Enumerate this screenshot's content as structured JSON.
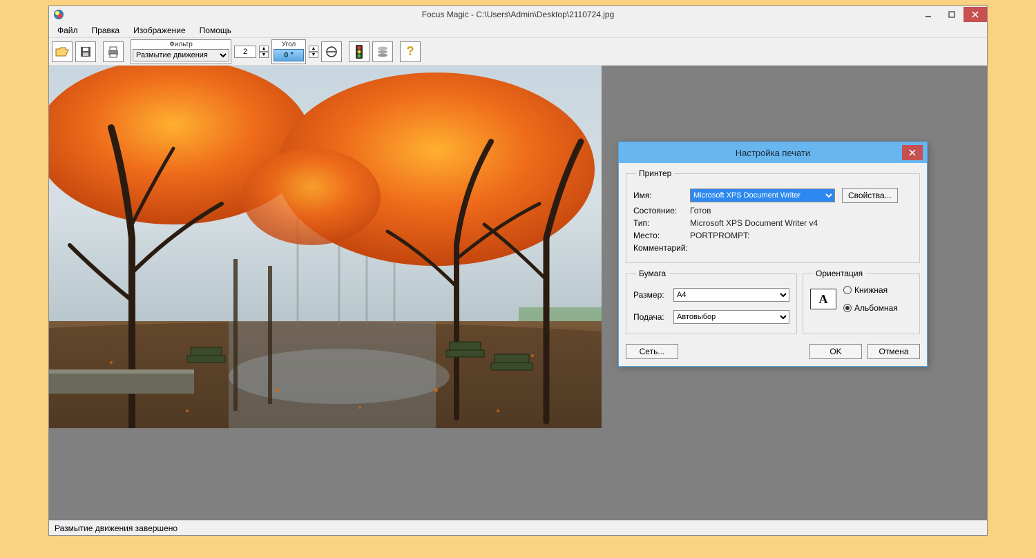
{
  "window": {
    "title": "Focus Magic - C:\\Users\\Admin\\Desktop\\2110724.jpg"
  },
  "menu": {
    "file": "Файл",
    "edit": "Правка",
    "image": "Изображение",
    "help": "Помощь"
  },
  "toolbar": {
    "filter_label": "Фильтр",
    "filter_value": "Размытие движения",
    "number_value": "2",
    "angle_label": "Угол",
    "angle_value": "0 °"
  },
  "status": {
    "text": "Размытие движения завершено"
  },
  "dialog": {
    "title": "Настройка печати",
    "printer_legend": "Принтер",
    "name_label": "Имя:",
    "name_value": "Microsoft XPS Document Writer",
    "properties_btn": "Свойства...",
    "state_label": "Состояние:",
    "state_value": "Готов",
    "type_label": "Тип:",
    "type_value": "Microsoft XPS Document Writer v4",
    "place_label": "Место:",
    "place_value": "PORTPROMPT:",
    "comment_label": "Комментарий:",
    "comment_value": "",
    "paper_legend": "Бумага",
    "size_label": "Размер:",
    "size_value": "A4",
    "feed_label": "Подача:",
    "feed_value": "Автовыбор",
    "orient_legend": "Ориентация",
    "portrait_label": "Книжная",
    "landscape_label": "Альбомная",
    "network_btn": "Сеть...",
    "ok_btn": "OK",
    "cancel_btn": "Отмена"
  }
}
